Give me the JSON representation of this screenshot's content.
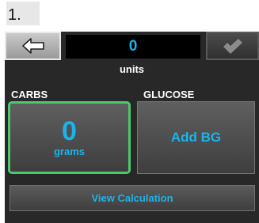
{
  "step_label": "1.",
  "header": {
    "units_value": "0",
    "back_icon": "left-arrow-icon",
    "confirm_icon": "checkmark-icon"
  },
  "units_label": "units",
  "carbs": {
    "section_label": "CARBS",
    "value": "0",
    "unit": "grams"
  },
  "glucose": {
    "section_label": "GLUCOSE",
    "button_label": "Add BG"
  },
  "view_calculation_label": "View Calculation",
  "colors": {
    "accent": "#1ab4ea",
    "selected_border": "#4ec96a",
    "panel_background": "#282828"
  }
}
